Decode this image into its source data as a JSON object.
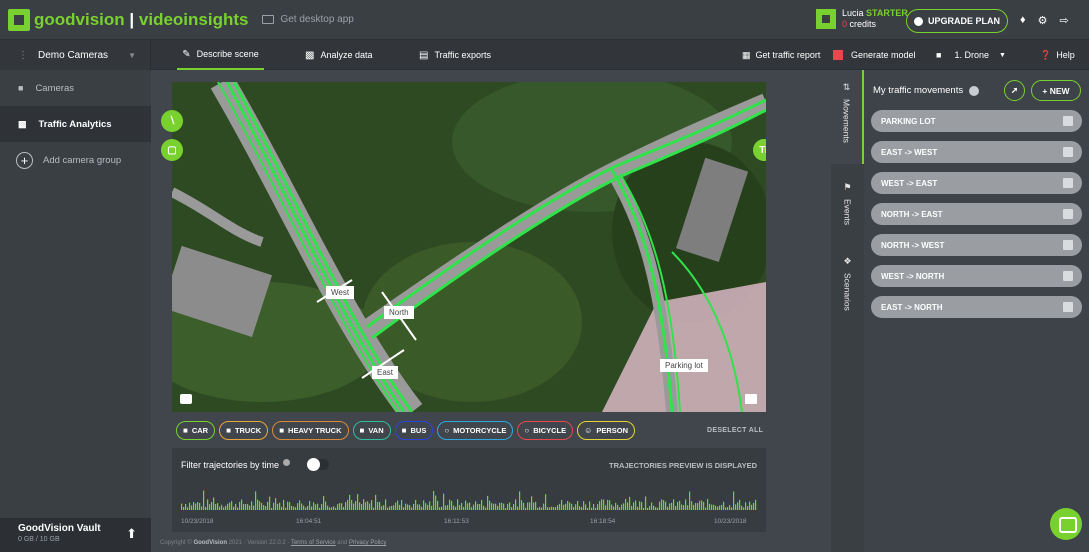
{
  "header": {
    "logo_left": "goodvision",
    "logo_sep": "| ",
    "logo_right": "videoinsights",
    "desktop_app": "Get desktop app",
    "user_name": "Lucia",
    "user_plan": "STARTER",
    "credits_count": "0",
    "credits_label": "credits",
    "upgrade_label": "UPGRADE PLAN"
  },
  "subbar": {
    "camera_group": "Demo Cameras",
    "tabs": [
      {
        "label": "Describe scene",
        "icon": "pencil-icon"
      },
      {
        "label": "Analyze data",
        "icon": "bar-chart-icon"
      },
      {
        "label": "Traffic exports",
        "icon": "file-icon"
      }
    ],
    "get_report": "Get traffic report",
    "generate_model": "Generate model",
    "drone": "1. Drone",
    "help": "Help"
  },
  "sidebar": {
    "items": [
      {
        "label": "Cameras",
        "icon": "video-camera-icon"
      },
      {
        "label": "Traffic Analytics",
        "icon": "bar-chart-icon"
      }
    ],
    "add_group": "Add camera group",
    "vault_title": "GoodVision Vault",
    "vault_size": "0 GB / 10 GB"
  },
  "video": {
    "labels": {
      "west": "West",
      "north": "North",
      "east": "East",
      "parking": "Parking lot"
    },
    "text_tool": "Tr"
  },
  "classes": [
    {
      "label": "CAR",
      "color": "#79d12f",
      "icon": "car-icon"
    },
    {
      "label": "TRUCK",
      "color": "#e7a73c",
      "icon": "truck-icon"
    },
    {
      "label": "HEAVY TRUCK",
      "color": "#d98b3a",
      "icon": "heavy-truck-icon"
    },
    {
      "label": "VAN",
      "color": "#2fbfa0",
      "icon": "van-icon"
    },
    {
      "label": "BUS",
      "color": "#2b46e0",
      "icon": "bus-icon"
    },
    {
      "label": "MOTORCYCLE",
      "color": "#2ea8e0",
      "icon": "motorcycle-icon"
    },
    {
      "label": "BICYCLE",
      "color": "#e5484d",
      "icon": "bicycle-icon"
    },
    {
      "label": "PERSON",
      "color": "#e8d33a",
      "icon": "person-icon"
    }
  ],
  "deselect_all": "DESELECT ALL",
  "timeline": {
    "filter_label": "Filter trajectories by time",
    "status": "TRAJECTORIES PREVIEW IS DISPLAYED",
    "ticks": [
      "10/23/2018",
      "16:04:51",
      "16:11:53",
      "16:18:54",
      "10/23/2018"
    ]
  },
  "footer": {
    "copyright": "Copyright © ",
    "brand": "GoodVision",
    "year_version": " 2021 · Version 22.0.2 · ",
    "terms": "Terms of Service",
    "and": " and ",
    "privacy": "Privacy Policy"
  },
  "rail": {
    "tabs": [
      {
        "label": "Movements",
        "icon": "movements-icon"
      },
      {
        "label": "Events",
        "icon": "flag-icon"
      },
      {
        "label": "Scenarios",
        "icon": "puzzle-icon"
      }
    ]
  },
  "movements": {
    "title": "My traffic movements",
    "new_label": "+ NEW",
    "items": [
      "PARKING LOT",
      "EAST -> WEST",
      "WEST -> EAST",
      "NORTH -> EAST",
      "NORTH -> WEST",
      "WEST -> NORTH",
      "EAST -> NORTH"
    ]
  },
  "colors": {
    "accent": "#79d12f",
    "panel": "#3a3f44"
  }
}
